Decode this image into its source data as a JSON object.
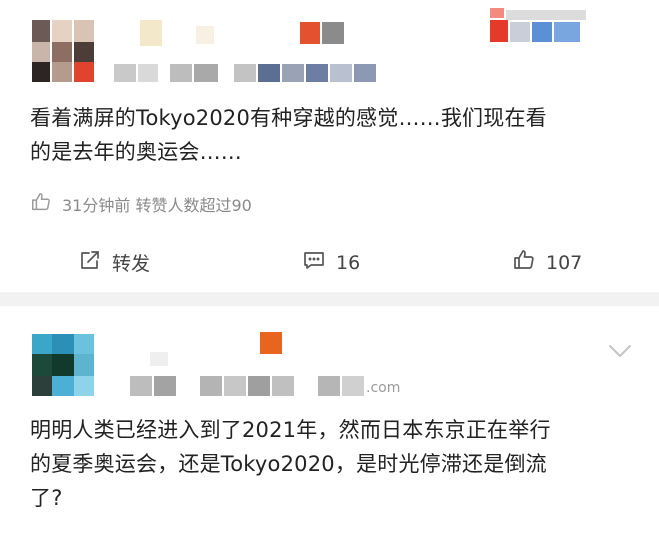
{
  "post1": {
    "text_line1": "看着满屏的Tokyo2020有种穿越的感觉……我们现在看",
    "text_line2": "的是去年的奥运会……",
    "meta_text": "31分钟前 转赞人数超过90",
    "actions": {
      "repost_label": "转发",
      "comment_count": "16",
      "like_count": "107"
    }
  },
  "post2": {
    "text_line1": "明明人类已经进入到了2021年，然而日本东京正在举行",
    "text_line2": "的夏季奥运会，还是Tokyo2020，是时光停滞还是倒流",
    "text_line3": "了?",
    "username_suffix": ".com"
  },
  "colors": {
    "divider": "#f2f2f2",
    "meta_gray": "#8a8a8a",
    "action_gray": "#444444"
  }
}
